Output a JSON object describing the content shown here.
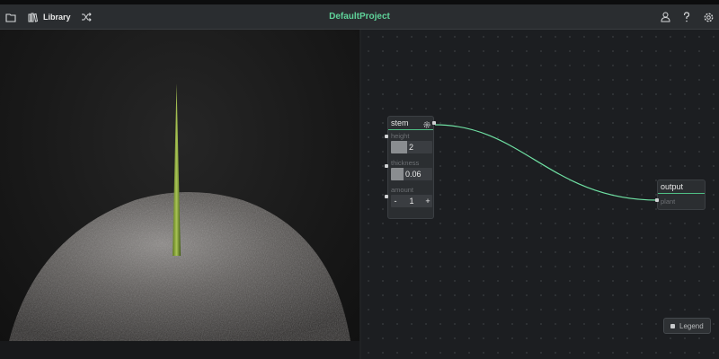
{
  "header": {
    "title": "DefaultProject",
    "library_label": "Library",
    "icons": [
      "folder-icon",
      "library-icon",
      "shuffle-icon",
      "user-icon",
      "help-icon",
      "settings-icon"
    ],
    "accent": "#5fd39a"
  },
  "nodes": {
    "stem": {
      "title": "stem",
      "params": {
        "height": {
          "label": "height",
          "value": "2"
        },
        "thickness": {
          "label": "thickness",
          "value": "0.06"
        },
        "amount": {
          "label": "amount",
          "value": "1",
          "minus": "-",
          "plus": "+"
        }
      }
    },
    "output": {
      "title": "output",
      "input_label": "plant"
    }
  },
  "legend": {
    "label": "Legend"
  }
}
